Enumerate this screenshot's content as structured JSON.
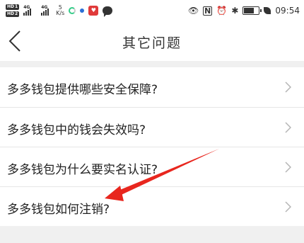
{
  "status_bar": {
    "sim1": "HD",
    "sim2": "HD",
    "net1": "4G",
    "net2": "4G",
    "speed_value": "5",
    "speed_unit": "K/s",
    "time": "09:54",
    "battery_level": 0.7
  },
  "nav": {
    "title": "其它问题"
  },
  "faq": {
    "items": [
      {
        "label": "多多钱包提供哪些安全保障?"
      },
      {
        "label": "多多钱包中的钱会失效吗?"
      },
      {
        "label": "多多钱包为什么要实名认证?"
      },
      {
        "label": "多多钱包如何注销?"
      }
    ]
  },
  "annotation": {
    "color": "#e8261e"
  },
  "colors": {
    "background": "#f0f0f0",
    "surface": "#ffffff",
    "divider": "#e6e6e6",
    "chevron": "#b5b5b5"
  },
  "icons": {
    "back": "chevron-left-icon",
    "item_arrow": "chevron-right-icon"
  }
}
